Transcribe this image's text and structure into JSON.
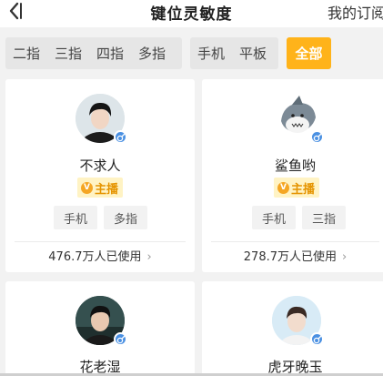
{
  "header": {
    "title": "键位灵敏度",
    "right_tab": "我的订阅"
  },
  "filters": {
    "fingers": [
      "二指",
      "三指",
      "四指",
      "多指"
    ],
    "devices": [
      "手机",
      "平板"
    ],
    "all": "全部",
    "active": "全部",
    "accent": "#ffb31a"
  },
  "cards": [
    {
      "name": "不求人",
      "badge": "主播",
      "badge_icon": "V",
      "tags": [
        "手机",
        "多指"
      ],
      "usage": "476.7万人已使用",
      "gender": "male"
    },
    {
      "name": "鲨鱼哟",
      "badge": "主播",
      "badge_icon": "V",
      "tags": [
        "手机",
        "三指"
      ],
      "usage": "278.7万人已使用",
      "gender": "male"
    },
    {
      "name": "花老湿",
      "gender": "male"
    },
    {
      "name": "虎牙晚玉",
      "gender": "male"
    }
  ],
  "chevron": "›"
}
